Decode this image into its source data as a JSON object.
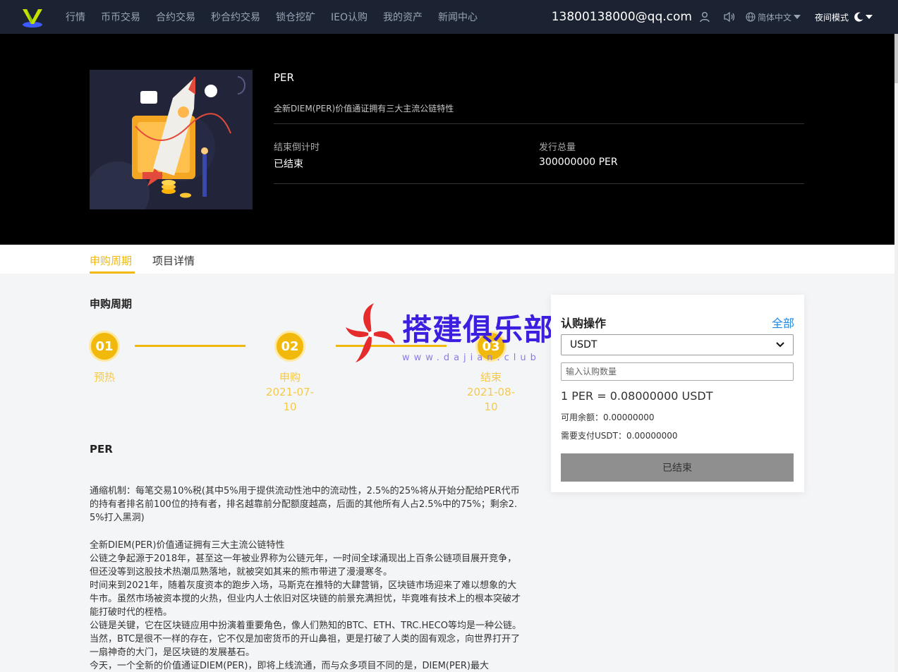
{
  "nav": {
    "items": [
      "行情",
      "币币交易",
      "合约交易",
      "秒合约交易",
      "锁仓挖矿",
      "IEO认购",
      "我的资产",
      "新闻中心"
    ]
  },
  "user": {
    "email": "13800138000@qq.com"
  },
  "language": {
    "label": "简体中文"
  },
  "night_mode": {
    "label": "夜间模式"
  },
  "hero": {
    "title": "PER",
    "description": "全新DIEM(PER)价值通证拥有三大主流公链特性",
    "countdown_label": "结束倒计时",
    "countdown_value": "已结束",
    "total_label": "发行总量",
    "total_value": "300000000 PER"
  },
  "tabs": [
    "申购周期",
    "项目详情"
  ],
  "cycle": {
    "title": "申购周期",
    "steps": [
      {
        "num": "01",
        "label": "预热",
        "date": ""
      },
      {
        "num": "02",
        "label": "申购",
        "date_line1": "2021-07-",
        "date_line2": "10"
      },
      {
        "num": "03",
        "label": "结束",
        "date_line1": "2021-08-",
        "date_line2": "10"
      }
    ]
  },
  "detail": {
    "heading": "PER",
    "para1": "通缩机制：每笔交易10%税(其中5%用于提供流动性池中的流动性，2.5%的25%将从开始分配给PER代币的持有者排名前100位的持有者，排名越靠前分配额度越高，后面的其他所有人占2.5%中的75%；剩余2.5%打入黑洞)",
    "para2_lines": [
      "全新DIEM(PER)价值通证拥有三大主流公链特性",
      "公链之争起源于2018年，甚至这一年被业界称为公链元年，一时间全球涌现出上百条公链项目展开竞争，但还没等到这股技术热潮瓜熟落地，就被突如其来的熊市带进了漫漫寒冬。",
      "时间来到2021年，随着灰度资本的跑步入场，马斯克在推特的大肆营销，区块链市场迎来了难以想象的大牛市。虽然市场被资本搅的火热，但业内人士依旧对区块链的前景充满担忧，毕竟唯有技术上的根本突破才能打破时代的桎梏。",
      "公链是关键，它在区块链应用中扮演着重要角色，像人们熟知的BTC、ETH、TRC.HECO等均是一种公链。当然，BTC是很不一样的存在，它不仅是加密货币的开山鼻祖，更是打破了人类的固有观念，向世界打开了一扇神奇的大门，是区块链的发展基石。",
      "今天，一个全新的价值通证DIEM(PER)，即将上线流通，而与众多项目不同的是，DIEM(PER)最大"
    ]
  },
  "panel": {
    "title": "认购操作",
    "all_label": "全部",
    "currency": "USDT",
    "input_placeholder": "输入认购数量",
    "rate": "1 PER = 0.08000000 USDT",
    "available": "可用余额：0.00000000",
    "payment": "需要支付USDT：0.00000000",
    "button_label": "已结束"
  },
  "watermark": {
    "text": "搭建俱乐部",
    "url": "www.dajian.club"
  },
  "colors": {
    "accent": "#f0b90b",
    "nav_bg": "#1b2332",
    "link": "#1e88e5"
  }
}
